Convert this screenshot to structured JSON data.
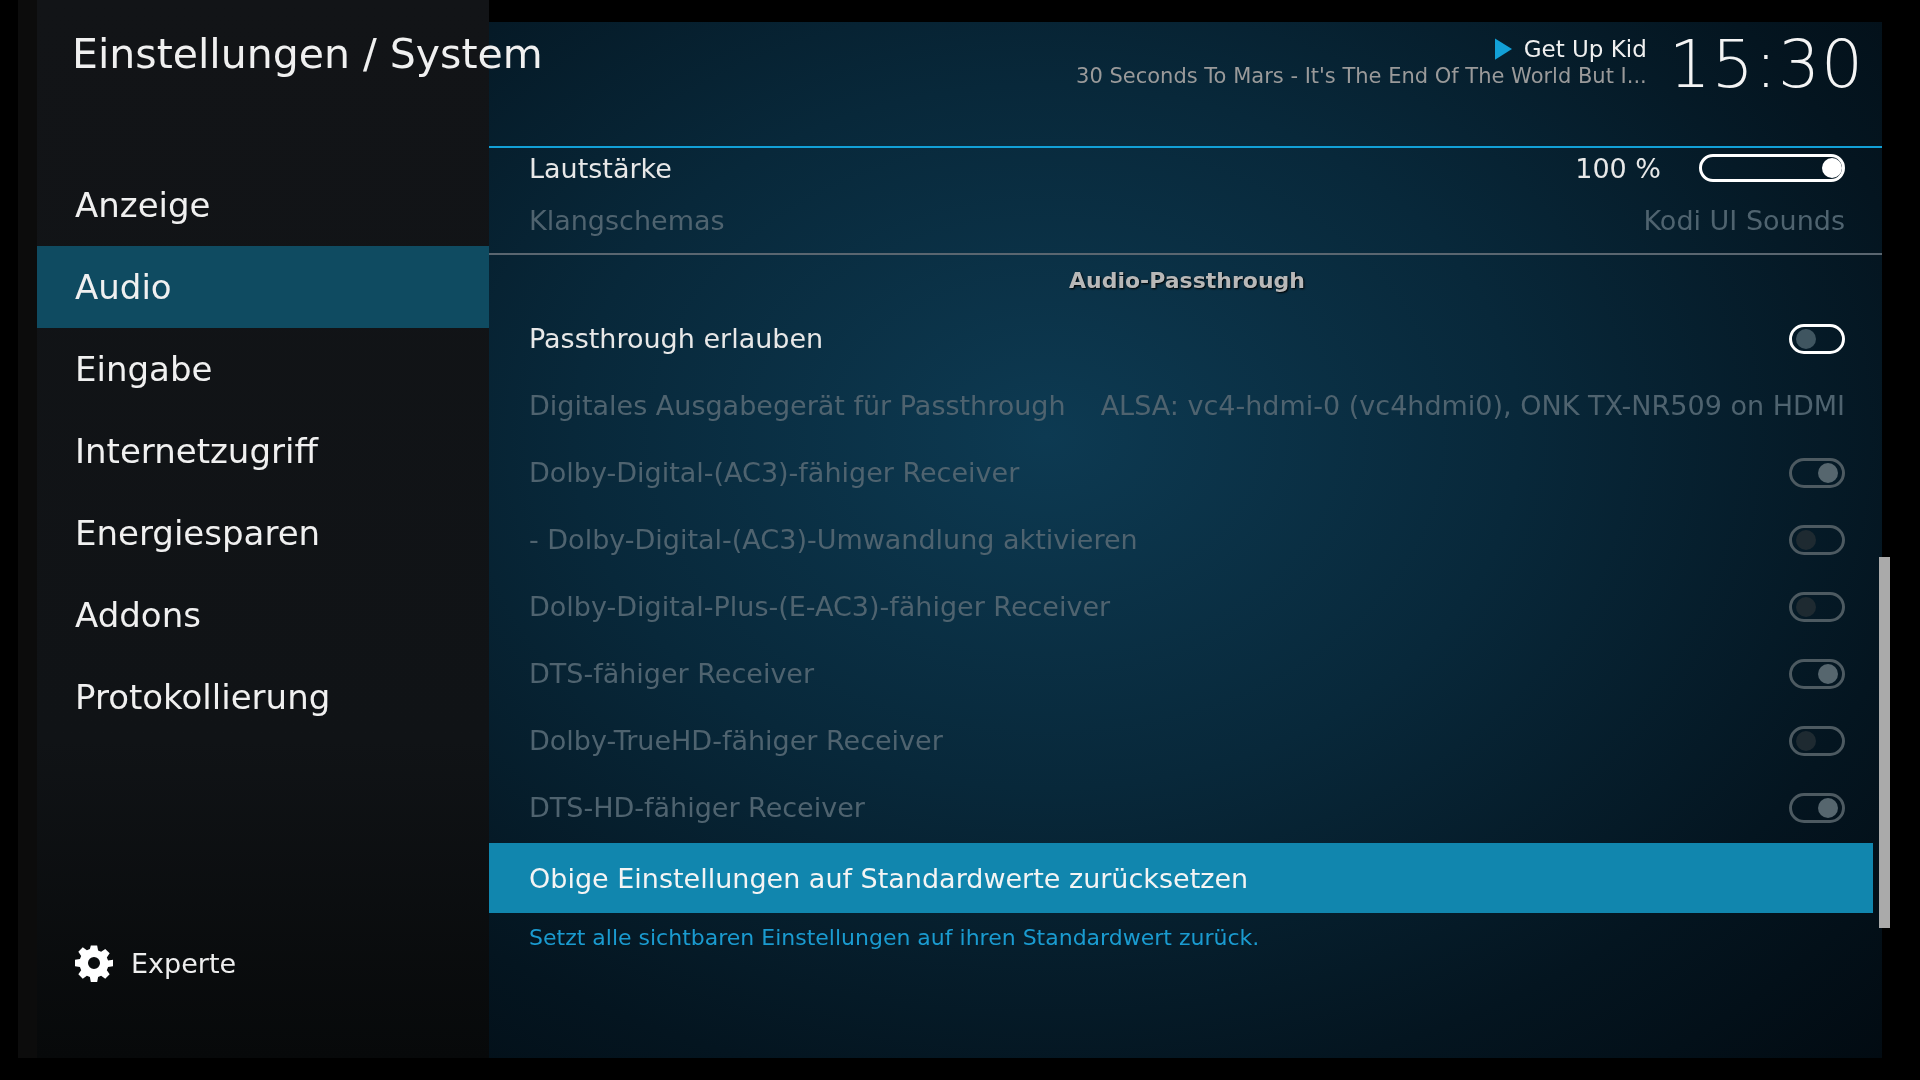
{
  "header": {
    "title": "Einstellungen / System",
    "now_playing": {
      "playing": true,
      "title": "Get Up Kid",
      "subtitle": "30 Seconds To Mars - It's The End Of The World But I..."
    },
    "clock": "15:30"
  },
  "sidebar": {
    "items": [
      {
        "label": "Anzeige",
        "selected": false
      },
      {
        "label": "Audio",
        "selected": true
      },
      {
        "label": "Eingabe",
        "selected": false
      },
      {
        "label": "Internetzugriff",
        "selected": false
      },
      {
        "label": "Energiesparen",
        "selected": false
      },
      {
        "label": "Addons",
        "selected": false
      },
      {
        "label": "Protokollierung",
        "selected": false
      }
    ],
    "expert": {
      "label": "Experte"
    }
  },
  "settings": [
    {
      "kind": "slider",
      "label": "Lautstärke",
      "value": "100 %",
      "level": 1,
      "disabled": false
    },
    {
      "kind": "value",
      "label": "Klangschemas",
      "value": "Kodi UI Sounds",
      "disabled": true
    },
    {
      "kind": "heading",
      "label": "Audio-Passthrough"
    },
    {
      "kind": "toggle",
      "label": "Passthrough erlauben",
      "on": false,
      "disabled": false
    },
    {
      "kind": "value",
      "label": "Digitales Ausgabegerät für Passthrough",
      "value": "ALSA: vc4-hdmi-0 (vc4hdmi0), ONK TX-NR509 on HDMI",
      "disabled": true
    },
    {
      "kind": "toggle",
      "label": "Dolby-Digital-(AC3)-fähiger Receiver",
      "on": true,
      "disabled": true
    },
    {
      "kind": "toggle",
      "label": "- Dolby-Digital-(AC3)-Umwandlung aktivieren",
      "on": false,
      "disabled": true
    },
    {
      "kind": "toggle",
      "label": "Dolby-Digital-Plus-(E-AC3)-fähiger Receiver",
      "on": false,
      "disabled": true
    },
    {
      "kind": "toggle",
      "label": "DTS-fähiger Receiver",
      "on": true,
      "disabled": true
    },
    {
      "kind": "toggle",
      "label": "Dolby-TrueHD-fähiger Receiver",
      "on": false,
      "disabled": true
    },
    {
      "kind": "toggle",
      "label": "DTS-HD-fähiger Receiver",
      "on": true,
      "disabled": true
    }
  ],
  "reset": {
    "label": "Obige Einstellungen auf Standardwerte zurücksetzen",
    "selected": true
  },
  "description": "Setzt alle sichtbaren Einstellungen auf ihren Standardwert zurück."
}
